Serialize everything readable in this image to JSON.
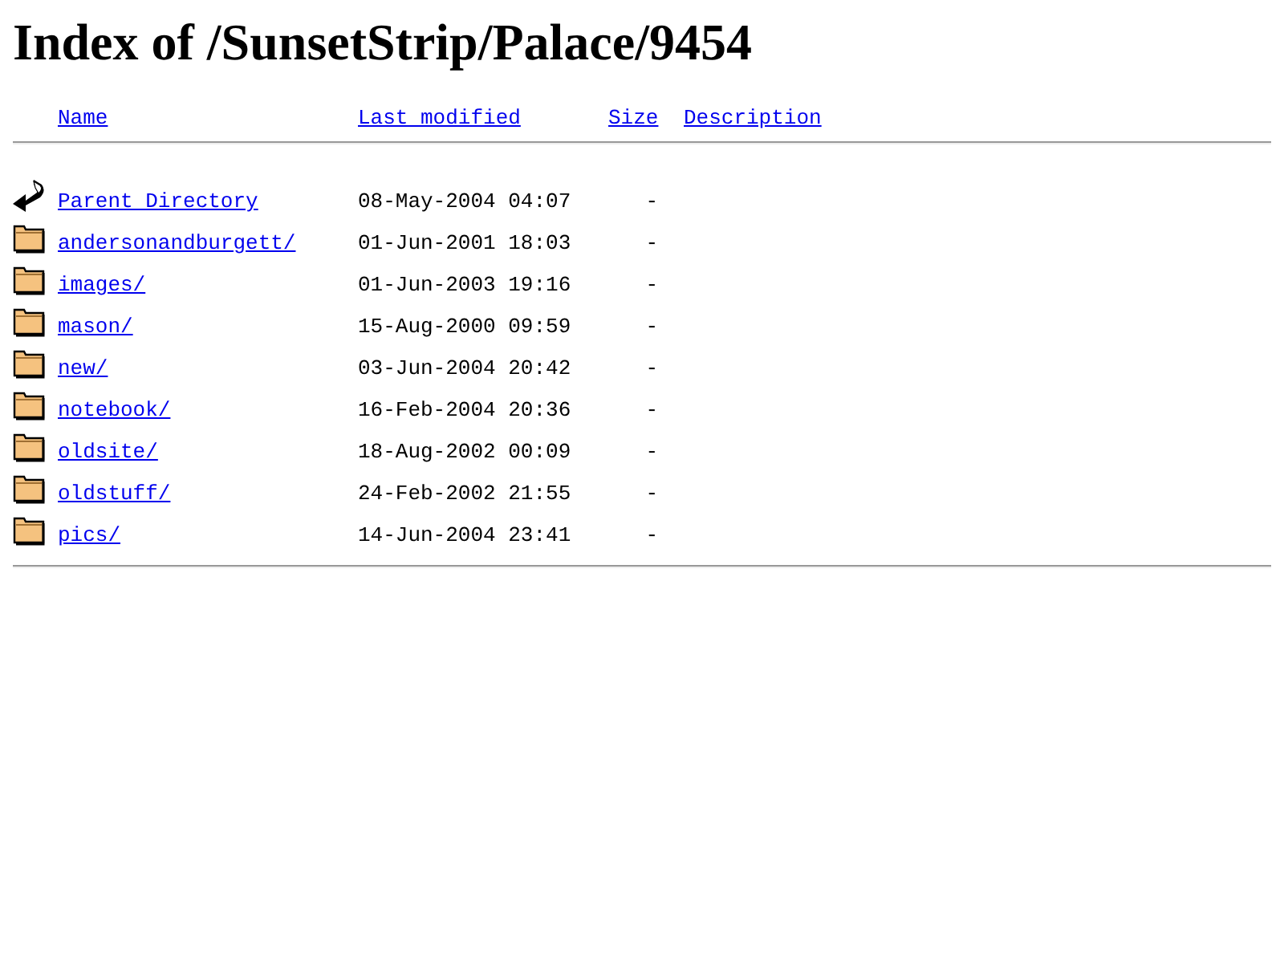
{
  "title": "Index of /SunsetStrip/Palace/9454",
  "columns": [
    {
      "label": "Name"
    },
    {
      "label": "Last modified"
    },
    {
      "label": "Size"
    },
    {
      "label": "Description"
    }
  ],
  "rows": [
    {
      "kind": "parent",
      "name": "Parent Directory",
      "modified": "08-May-2004 04:07",
      "size": "-"
    },
    {
      "kind": "folder",
      "name": "andersonandburgett/",
      "modified": "01-Jun-2001 18:03",
      "size": "-"
    },
    {
      "kind": "folder",
      "name": "images/",
      "modified": "01-Jun-2003 19:16",
      "size": "-"
    },
    {
      "kind": "folder",
      "name": "mason/",
      "modified": "15-Aug-2000 09:59",
      "size": "-"
    },
    {
      "kind": "folder",
      "name": "new/",
      "modified": "03-Jun-2004 20:42",
      "size": "-"
    },
    {
      "kind": "folder",
      "name": "notebook/",
      "modified": "16-Feb-2004 20:36",
      "size": "-"
    },
    {
      "kind": "folder",
      "name": "oldsite/",
      "modified": "18-Aug-2002 00:09",
      "size": "-"
    },
    {
      "kind": "folder",
      "name": "oldstuff/",
      "modified": "24-Feb-2002 21:55",
      "size": "-"
    },
    {
      "kind": "folder",
      "name": "pics/",
      "modified": "14-Jun-2004 23:41",
      "size": "-"
    }
  ]
}
